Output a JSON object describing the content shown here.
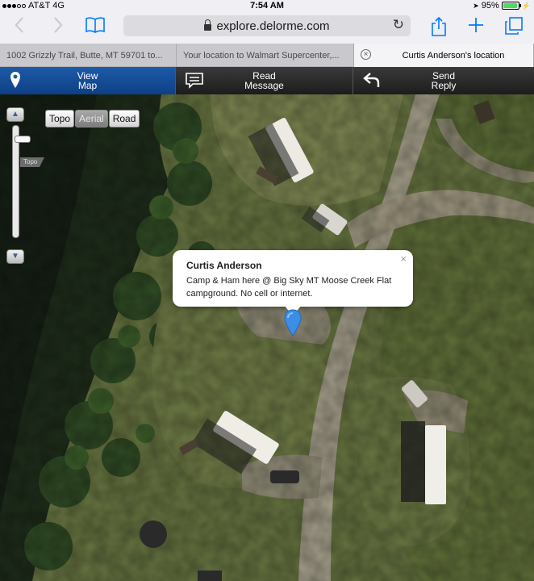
{
  "status_bar": {
    "carrier": "AT&T",
    "network": "4G",
    "time": "7:54 AM",
    "battery": "95%",
    "battery_level": 0.95
  },
  "browser": {
    "url": "explore.delorme.com",
    "icons": [
      "back-icon",
      "forward-icon",
      "bookmarks-icon",
      "lock-icon",
      "reload-icon",
      "share-icon",
      "new-tab-icon",
      "tabs-icon"
    ],
    "tabs": [
      {
        "label": "1002 Grizzly Trail, Butte, MT 59701 to..."
      },
      {
        "label": "Your location to Walmart Supercenter,..."
      },
      {
        "label": "Curtis Anderson's location",
        "active": true
      }
    ]
  },
  "nav": {
    "items": [
      {
        "label_line1": "View",
        "label_line2": "Map",
        "icon": "map-pin-icon",
        "active": true
      },
      {
        "label_line1": "Read",
        "label_line2": "Message",
        "icon": "message-icon"
      },
      {
        "label_line1": "Send",
        "label_line2": "Reply",
        "icon": "reply-icon"
      }
    ]
  },
  "map": {
    "map_types": [
      "Topo",
      "Aerial",
      "Road"
    ],
    "selected_type": "Aerial",
    "zoom_flag": "Topo",
    "popup": {
      "title": "Curtis Anderson",
      "body": "Camp & Ham here @ Big Sky MT Moose Creek Flat campground. No cell or internet.",
      "close": "×"
    }
  },
  "colors": {
    "accent": "#007aff",
    "nav_active": "#1d5aa8",
    "pin": "#3a8ee6"
  }
}
